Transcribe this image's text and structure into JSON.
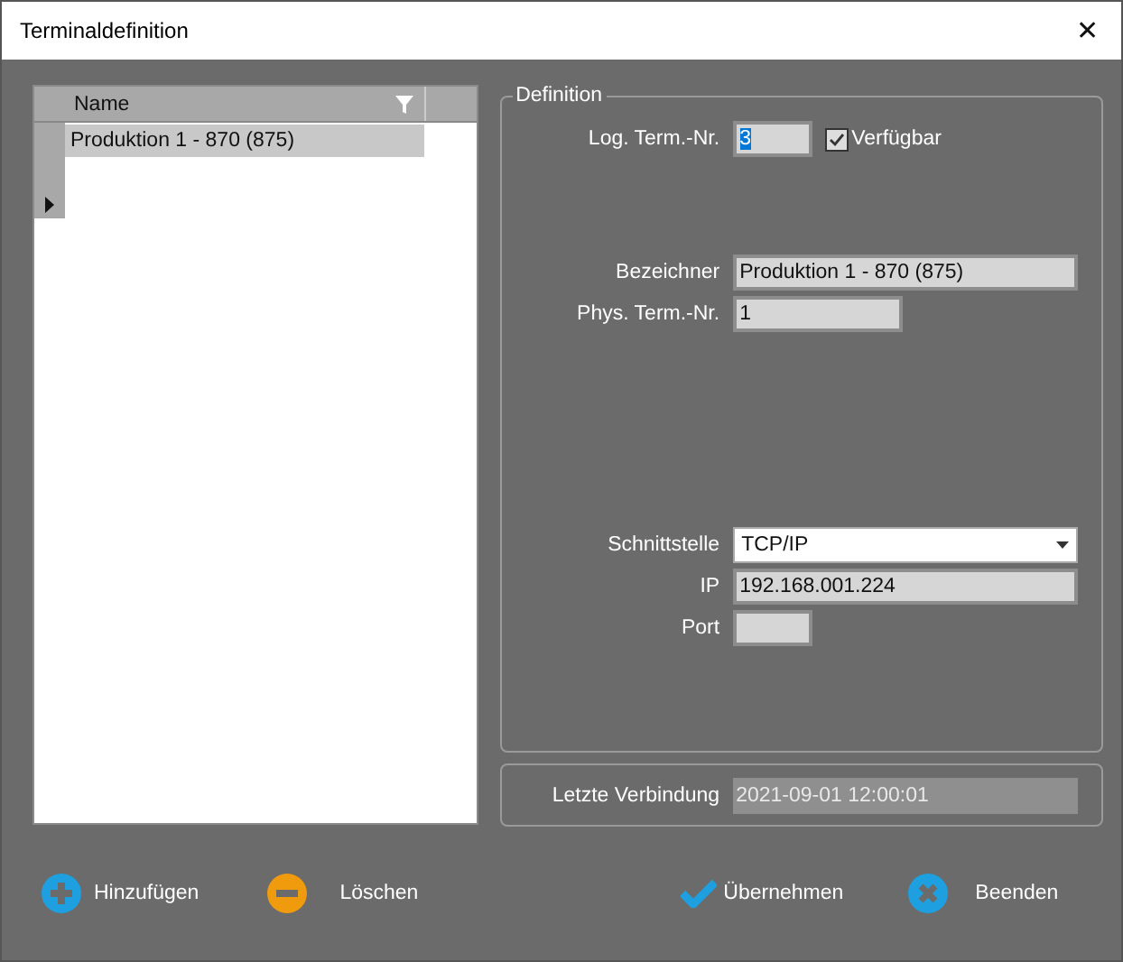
{
  "window": {
    "title": "Terminaldefinition",
    "close": "✕"
  },
  "grid": {
    "columns": [
      {
        "label": "Name",
        "filter": true
      }
    ],
    "rows": [
      {
        "name": "Produktion 1 -  870 (875)",
        "selected": true,
        "current": false
      }
    ],
    "new_row": {
      "current": true
    }
  },
  "definition": {
    "legend": "Definition",
    "groups": [
      [
        {
          "kind": "short",
          "label": "Log. Term.-Nr.",
          "value": "3",
          "text_selected": true,
          "checkbox": {
            "label": "Verfügbar",
            "checked": true
          }
        }
      ],
      [
        {
          "kind": "wide",
          "label": "Bezeichner",
          "value": "Produktion 1 -  870 (875)"
        },
        {
          "kind": "medium",
          "label": "Phys. Term.-Nr.",
          "value": "1"
        }
      ],
      [
        {
          "kind": "combo",
          "label": "Schnittstelle",
          "value": "TCP/IP"
        },
        {
          "kind": "wide",
          "label": "IP",
          "value": "192.168.001.224"
        },
        {
          "kind": "short",
          "label": "Port"
        }
      ]
    ]
  },
  "last_connection": {
    "label": "Letzte Verbindung",
    "value": "2021-09-01 12:00:01"
  },
  "buttons": [
    {
      "kind": "add",
      "label": "Hinzufügen"
    },
    {
      "kind": "remove",
      "label": "Löschen"
    },
    {
      "kind": "apply",
      "label": "Übernehmen"
    },
    {
      "kind": "exit",
      "label": "Beenden"
    }
  ]
}
